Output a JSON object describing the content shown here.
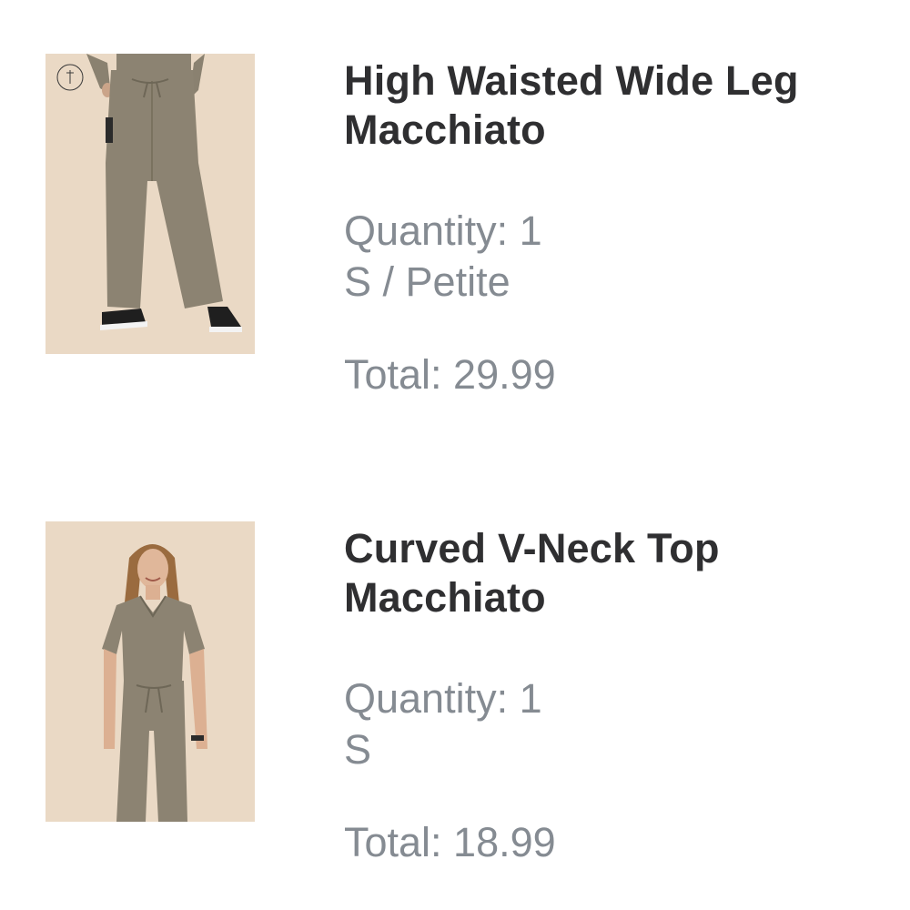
{
  "cart": {
    "items": [
      {
        "title_line1": "High Waisted Wide Leg",
        "title_line2": "Macchiato",
        "quantity": "Quantity: 1",
        "variant": "S / Petite",
        "total": "Total: 29.99",
        "image_icon": "product-photo-pants",
        "badge_icon": "high-waisted-badge"
      },
      {
        "title_line1": "Curved V-Neck Top",
        "title_line2": "Macchiato",
        "quantity": "Quantity: 1",
        "variant": "S",
        "total": "Total: 18.99",
        "image_icon": "product-photo-top"
      }
    ]
  },
  "colors": {
    "background": "#ffffff",
    "title": "#2f2f31",
    "secondary_text": "#858b92",
    "image_background": "#ead9c5",
    "garment": "#8c8372"
  }
}
